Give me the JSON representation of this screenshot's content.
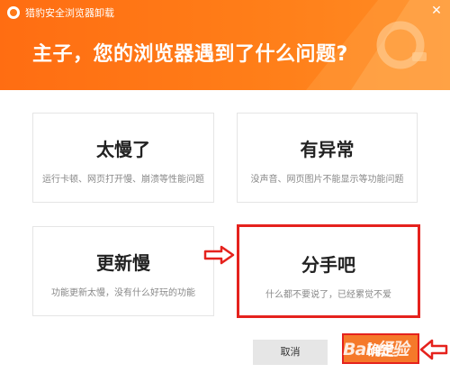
{
  "window": {
    "title": "猎豹安全浏览器卸载",
    "close_symbol": "✕"
  },
  "header": {
    "heading": "主子，您的浏览器遇到了什么问题?"
  },
  "options": [
    {
      "title": "太慢了",
      "desc": "运行卡顿、网页打开慢、崩溃等性能问题",
      "selected": false
    },
    {
      "title": "有异常",
      "desc": "没声音、网页图片不能显示等功能问题",
      "selected": false
    },
    {
      "title": "更新慢",
      "desc": "功能更新太慢，没有什么好玩的功能",
      "selected": false
    },
    {
      "title": "分手吧",
      "desc": "什么都不要说了，已经累觉不爱",
      "selected": true
    }
  ],
  "buttons": {
    "cancel": "取消",
    "confirm": "确定"
  },
  "watermark": "Bai 经验",
  "colors": {
    "header": "#ff7a18",
    "annotation_red": "#e5221d",
    "confirm": "#f5792a"
  },
  "icons": [
    "logo-icon",
    "close-icon",
    "red-arrow-icon"
  ]
}
